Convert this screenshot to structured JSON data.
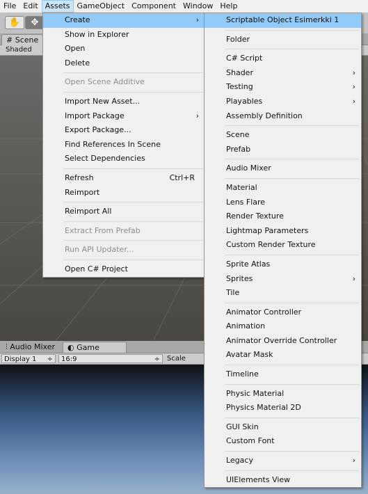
{
  "menubar": {
    "items": [
      "File",
      "Edit",
      "Assets",
      "GameObject",
      "Component",
      "Window",
      "Help"
    ],
    "active_index": 2
  },
  "scene": {
    "tab_label": "Scene",
    "shading_mode": "Shaded"
  },
  "game": {
    "tabs": [
      "Audio Mixer",
      "Game"
    ],
    "display": "Display 1",
    "aspect": "16:9",
    "scale_label": "Scale"
  },
  "assets_menu": {
    "groups": [
      [
        {
          "label": "Create",
          "submenu": true,
          "highlighted": true
        },
        {
          "label": "Show in Explorer"
        },
        {
          "label": "Open"
        },
        {
          "label": "Delete"
        }
      ],
      [
        {
          "label": "Open Scene Additive",
          "disabled": true
        }
      ],
      [
        {
          "label": "Import New Asset..."
        },
        {
          "label": "Import Package",
          "submenu": true
        },
        {
          "label": "Export Package..."
        },
        {
          "label": "Find References In Scene"
        },
        {
          "label": "Select Dependencies"
        }
      ],
      [
        {
          "label": "Refresh",
          "shortcut": "Ctrl+R"
        },
        {
          "label": "Reimport"
        }
      ],
      [
        {
          "label": "Reimport All"
        }
      ],
      [
        {
          "label": "Extract From Prefab",
          "disabled": true
        }
      ],
      [
        {
          "label": "Run API Updater...",
          "disabled": true
        }
      ],
      [
        {
          "label": "Open C# Project"
        }
      ]
    ]
  },
  "create_menu": {
    "groups": [
      [
        {
          "label": "Scriptable Object Esimerkki 1",
          "highlighted": true
        }
      ],
      [
        {
          "label": "Folder"
        }
      ],
      [
        {
          "label": "C# Script"
        },
        {
          "label": "Shader",
          "submenu": true
        },
        {
          "label": "Testing",
          "submenu": true
        },
        {
          "label": "Playables",
          "submenu": true
        },
        {
          "label": "Assembly Definition"
        }
      ],
      [
        {
          "label": "Scene"
        },
        {
          "label": "Prefab"
        }
      ],
      [
        {
          "label": "Audio Mixer"
        }
      ],
      [
        {
          "label": "Material"
        },
        {
          "label": "Lens Flare"
        },
        {
          "label": "Render Texture"
        },
        {
          "label": "Lightmap Parameters"
        },
        {
          "label": "Custom Render Texture"
        }
      ],
      [
        {
          "label": "Sprite Atlas"
        },
        {
          "label": "Sprites",
          "submenu": true
        },
        {
          "label": "Tile"
        }
      ],
      [
        {
          "label": "Animator Controller"
        },
        {
          "label": "Animation"
        },
        {
          "label": "Animator Override Controller"
        },
        {
          "label": "Avatar Mask"
        }
      ],
      [
        {
          "label": "Timeline"
        }
      ],
      [
        {
          "label": "Physic Material"
        },
        {
          "label": "Physics Material 2D"
        }
      ],
      [
        {
          "label": "GUI Skin"
        },
        {
          "label": "Custom Font"
        }
      ],
      [
        {
          "label": "Legacy",
          "submenu": true
        }
      ],
      [
        {
          "label": "UIElements View"
        }
      ]
    ]
  },
  "icons": {
    "arrow": "submenu-arrow-icon",
    "hand": "hand-tool-icon",
    "move": "move-tool-icon"
  },
  "colors": {
    "menu_highlight": "#91c9f7",
    "menubar_active": "#cce4f7"
  }
}
